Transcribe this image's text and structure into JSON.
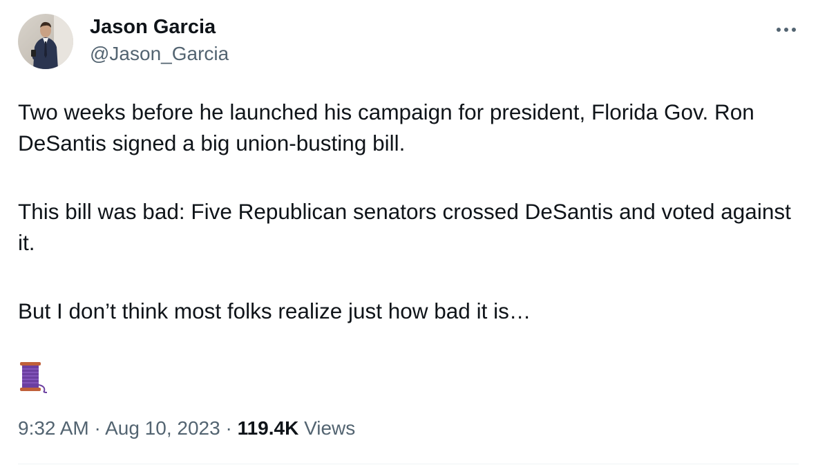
{
  "author": {
    "display_name": "Jason Garcia",
    "handle": "@Jason_Garcia"
  },
  "more_icon": "more-horizontal-icon",
  "tweet": {
    "paragraphs": [
      "Two weeks before he launched his campaign for president, Florida Gov. Ron DeSantis signed a big union-busting bill.",
      "This bill was bad: Five Republican senators crossed DeSantis and voted against it.",
      "But I don’t think most folks realize just how bad it is…"
    ],
    "emoji": "thread-spool-icon"
  },
  "meta": {
    "time": "9:32 AM",
    "separator": "·",
    "date": "Aug 10, 2023",
    "views_count": "119.4K",
    "views_label": "Views"
  },
  "colors": {
    "text_primary": "#0f1419",
    "text_secondary": "#536471",
    "divider": "#eff3f4",
    "spool_thread": "#6b3fa0",
    "spool_wood": "#c0603a"
  }
}
